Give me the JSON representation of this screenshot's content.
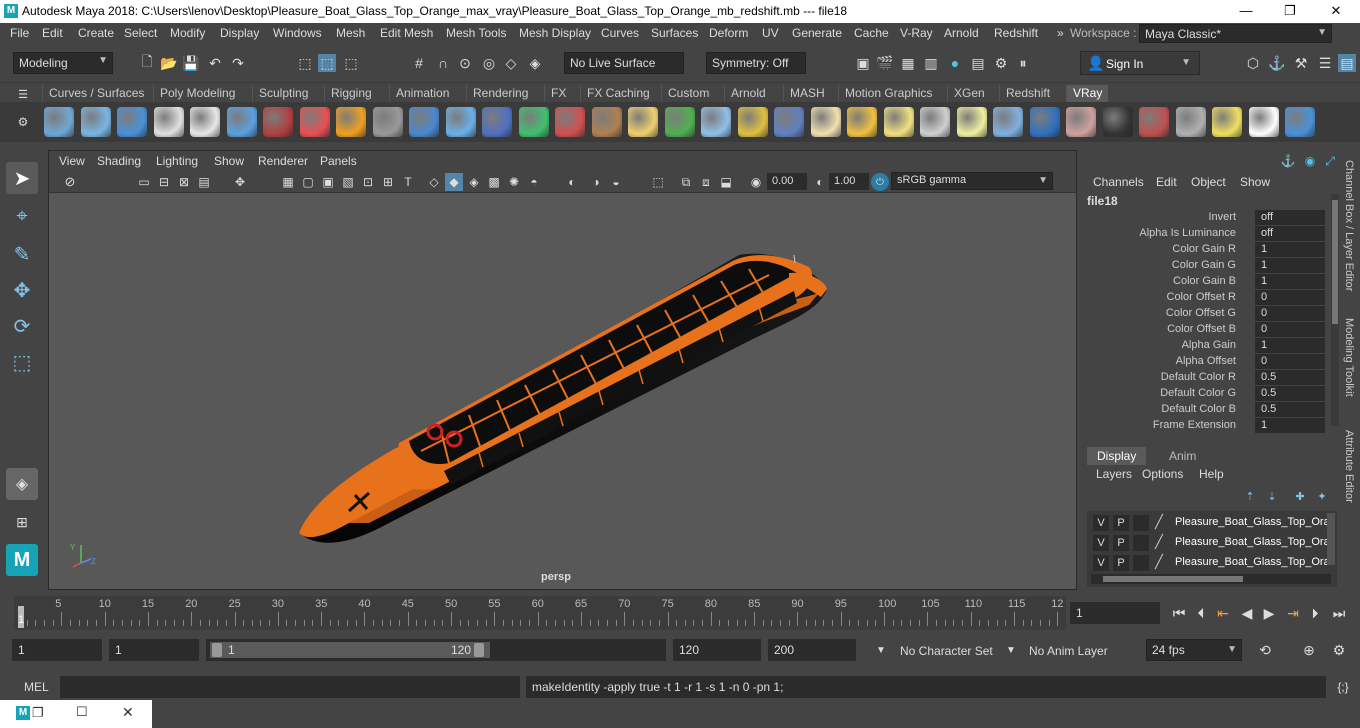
{
  "window": {
    "title": "Autodesk Maya 2018: C:\\Users\\lenov\\Desktop\\Pleasure_Boat_Glass_Top_Orange_max_vray\\Pleasure_Boat_Glass_Top_Orange_mb_redshift.mb   ---   file18",
    "min": "—",
    "max": "❐",
    "close": "✕"
  },
  "menubar": {
    "items": [
      "File",
      "Edit",
      "Create",
      "Select",
      "Modify",
      "Display",
      "Windows",
      "Mesh",
      "Edit Mesh",
      "Mesh Tools",
      "Mesh Display",
      "Curves",
      "Surfaces",
      "Deform",
      "UV",
      "Generate",
      "Cache",
      "V-Ray",
      "Arnold",
      "Redshift"
    ],
    "overflow": "»",
    "workspace_label": "Workspace :",
    "workspace_value": "Maya Classic*"
  },
  "statusline": {
    "mode": "Modeling",
    "live_surface": "No Live Surface",
    "symmetry": "Symmetry: Off",
    "sign_in": "Sign In"
  },
  "shelf": {
    "tabs": [
      "Curves / Surfaces",
      "Poly Modeling",
      "Sculpting",
      "Rigging",
      "Animation",
      "Rendering",
      "FX",
      "FX Caching",
      "Custom",
      "Arnold",
      "MASH",
      "Motion Graphics",
      "XGen",
      "Redshift",
      "VRay"
    ],
    "active_tab": "VRay",
    "icon_colors": [
      "#6fa8d6",
      "#79b6e3",
      "#4a90d9",
      "#e0e0e0",
      "#e8e8e8",
      "#5aa0e0",
      "#b04040",
      "#e85050",
      "#f0a020",
      "#999999",
      "#4a88d0",
      "#6ab0e8",
      "#5070c0",
      "#40c070",
      "#d05050",
      "#b08050",
      "#f0d070",
      "#50b050",
      "#90c0e8",
      "#e0c040",
      "#6080c0",
      "#f0e0b0",
      "#f0c040",
      "#f0e080",
      "#d0d0d0",
      "#f0f0a0",
      "#80b0e0",
      "#3070c0",
      "#d0a0a0",
      "#333333",
      "#c05050",
      "#b0b0b0",
      "#f0e060",
      "#ffffff",
      "#4a90d9"
    ]
  },
  "viewport": {
    "menu": [
      "View",
      "Shading",
      "Lighting",
      "Show",
      "Renderer",
      "Panels"
    ],
    "exposure": "0.00",
    "gamma": "1.00",
    "color_space": "sRGB gamma",
    "camera_label": "persp",
    "axis_y": "Y",
    "axis_z": "Z"
  },
  "channelbox": {
    "menu": [
      "Channels",
      "Edit",
      "Object",
      "Show"
    ],
    "node": "file18",
    "attributes": [
      {
        "name": "Invert",
        "value": "off"
      },
      {
        "name": "Alpha Is Luminance",
        "value": "off"
      },
      {
        "name": "Color Gain R",
        "value": "1"
      },
      {
        "name": "Color Gain G",
        "value": "1"
      },
      {
        "name": "Color Gain B",
        "value": "1"
      },
      {
        "name": "Color Offset R",
        "value": "0"
      },
      {
        "name": "Color Offset G",
        "value": "0"
      },
      {
        "name": "Color Offset B",
        "value": "0"
      },
      {
        "name": "Alpha Gain",
        "value": "1"
      },
      {
        "name": "Alpha Offset",
        "value": "0"
      },
      {
        "name": "Default Color R",
        "value": "0.5"
      },
      {
        "name": "Default Color G",
        "value": "0.5"
      },
      {
        "name": "Default Color B",
        "value": "0.5"
      },
      {
        "name": "Frame Extension",
        "value": "1"
      }
    ]
  },
  "layers": {
    "tabs": [
      "Display",
      "Anim"
    ],
    "menu": [
      "Layers",
      "Options",
      "Help"
    ],
    "rows": [
      {
        "v": "V",
        "p": "P",
        "name": "Pleasure_Boat_Glass_Top_Ora"
      },
      {
        "v": "V",
        "p": "P",
        "name": "Pleasure_Boat_Glass_Top_Ora"
      },
      {
        "v": "V",
        "p": "P",
        "name": "Pleasure_Boat_Glass_Top_Ora"
      }
    ]
  },
  "side_tabs": [
    "Channel Box / Layer Editor",
    "Modeling Toolkit",
    "Attribute Editor"
  ],
  "timeline": {
    "ticks": [
      "5",
      "10",
      "15",
      "20",
      "25",
      "30",
      "35",
      "40",
      "45",
      "50",
      "55",
      "60",
      "65",
      "70",
      "75",
      "80",
      "85",
      "90",
      "95",
      "100",
      "105",
      "110",
      "115",
      "12"
    ],
    "current_frame_marker": "1",
    "current_frame": "1"
  },
  "range": {
    "start": "1",
    "playback_start": "1",
    "slider_start": "1",
    "slider_end": "120",
    "playback_end": "120",
    "end": "200",
    "character_set": "No Character Set",
    "anim_layer": "No Anim Layer",
    "fps": "24 fps"
  },
  "command": {
    "lang": "MEL",
    "feedback": "makeIdentity -apply true -t 1 -r 1 -s 1 -n 0 -pn 1;"
  },
  "colors": {
    "accent": "#5285a6",
    "boat_orange": "#e8711c",
    "boat_black": "#0d0d0d",
    "viewport_bg": "#585858"
  }
}
